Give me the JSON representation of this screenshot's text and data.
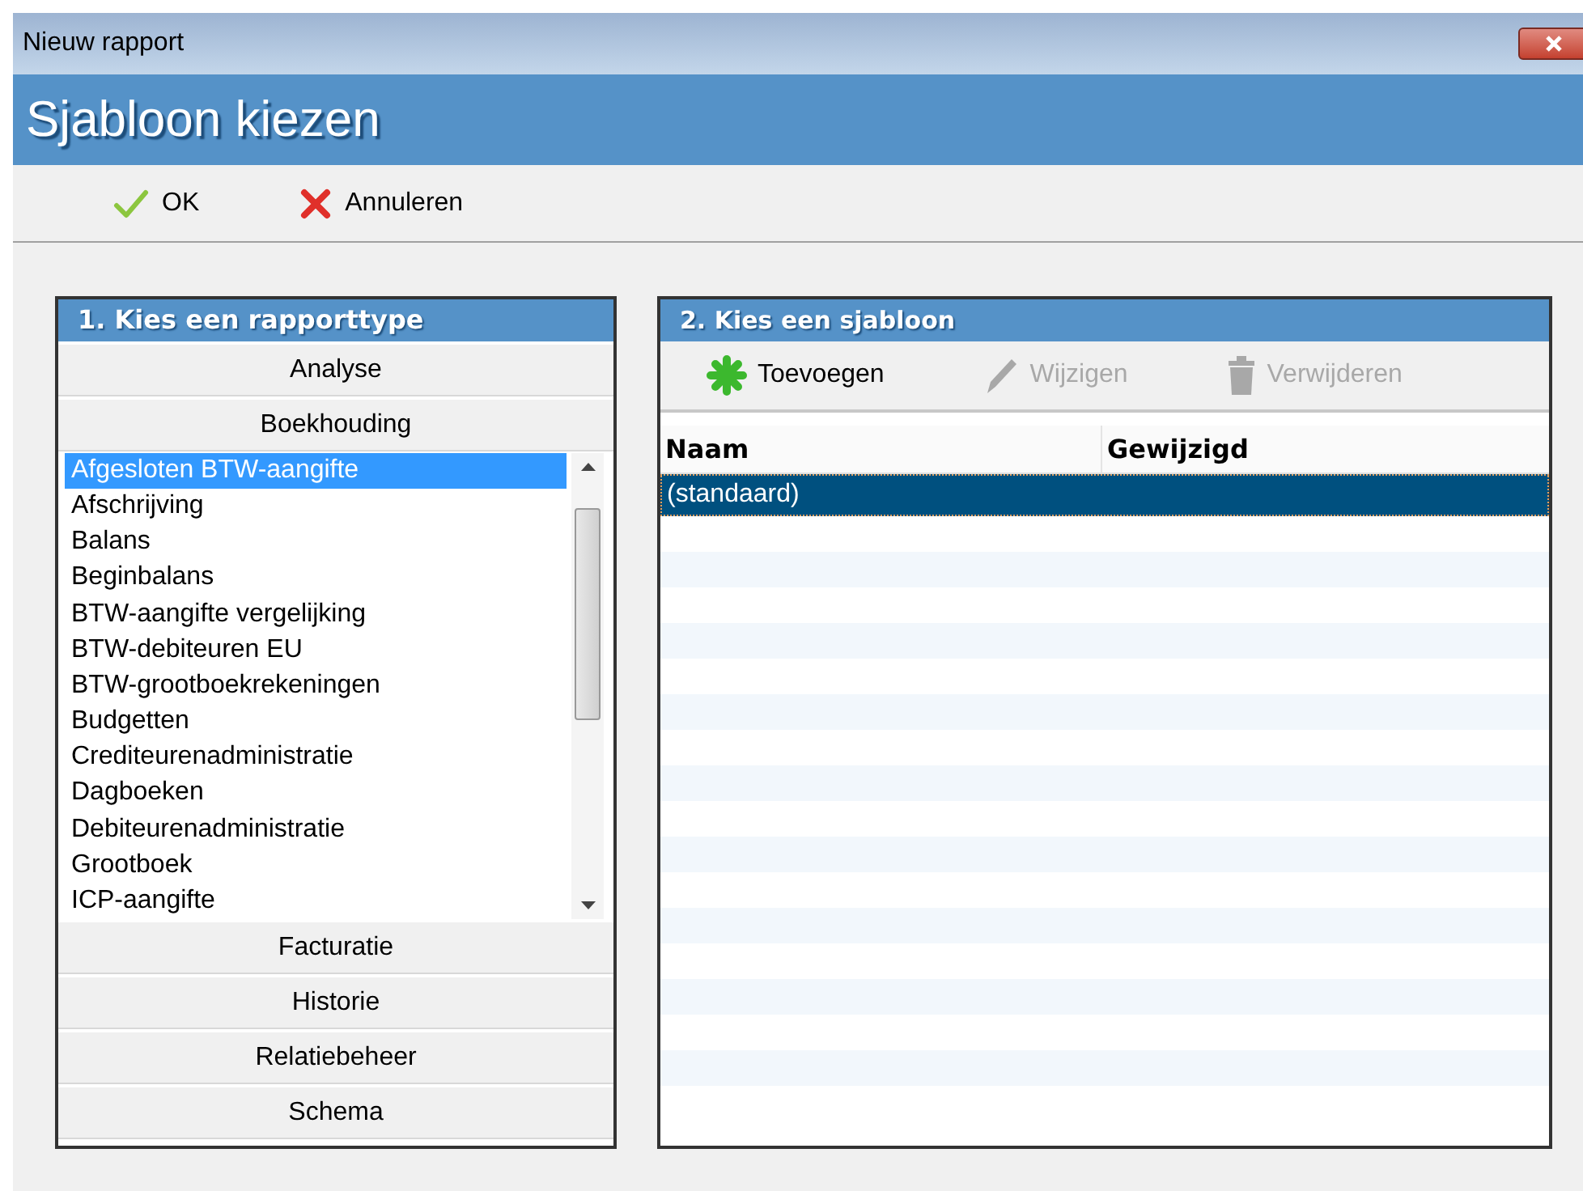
{
  "window": {
    "title": "Nieuw rapport",
    "header": "Sjabloon kiezen"
  },
  "toolbar": [
    {
      "label": "OK",
      "kind": "ok"
    },
    {
      "label": "Annuleren",
      "kind": "cancel"
    }
  ],
  "report_types": {
    "title": "1. Kies een rapporttype",
    "groups": [
      {
        "label": "Analyse"
      },
      {
        "label": "Boekhouding",
        "items": [
          {
            "label": "Afgesloten BTW-aangifte",
            "selected": true
          },
          {
            "label": "Afschrijving",
            "selected": false
          },
          {
            "label": "Balans",
            "selected": false
          },
          {
            "label": "Beginbalans",
            "selected": false
          },
          {
            "label": "BTW-aangifte vergelijking",
            "selected": false
          },
          {
            "label": "BTW-debiteuren EU",
            "selected": false
          },
          {
            "label": "BTW-grootboekrekeningen",
            "selected": false
          },
          {
            "label": "Budgetten",
            "selected": false
          },
          {
            "label": "Crediteurenadministratie",
            "selected": false
          },
          {
            "label": "Dagboeken",
            "selected": false
          },
          {
            "label": "Debiteurenadministratie",
            "selected": false
          },
          {
            "label": "Grootboek",
            "selected": false
          },
          {
            "label": "ICP-aangifte",
            "selected": false
          }
        ]
      },
      {
        "label": "Facturatie"
      },
      {
        "label": "Historie"
      },
      {
        "label": "Relatiebeheer"
      },
      {
        "label": "Schema"
      }
    ]
  },
  "templates": {
    "title": "2. Kies een sjabloon",
    "actions": [
      {
        "label": "Toevoegen",
        "kind": "add",
        "disabled": false
      },
      {
        "label": "Wijzigen",
        "kind": "edit",
        "disabled": true
      },
      {
        "label": "Verwijderen",
        "kind": "delete",
        "disabled": true
      }
    ],
    "columns": [
      "Naam",
      "Gewijzigd"
    ],
    "rows": [
      {
        "naam": "(standaard)",
        "selected": true
      }
    ]
  }
}
